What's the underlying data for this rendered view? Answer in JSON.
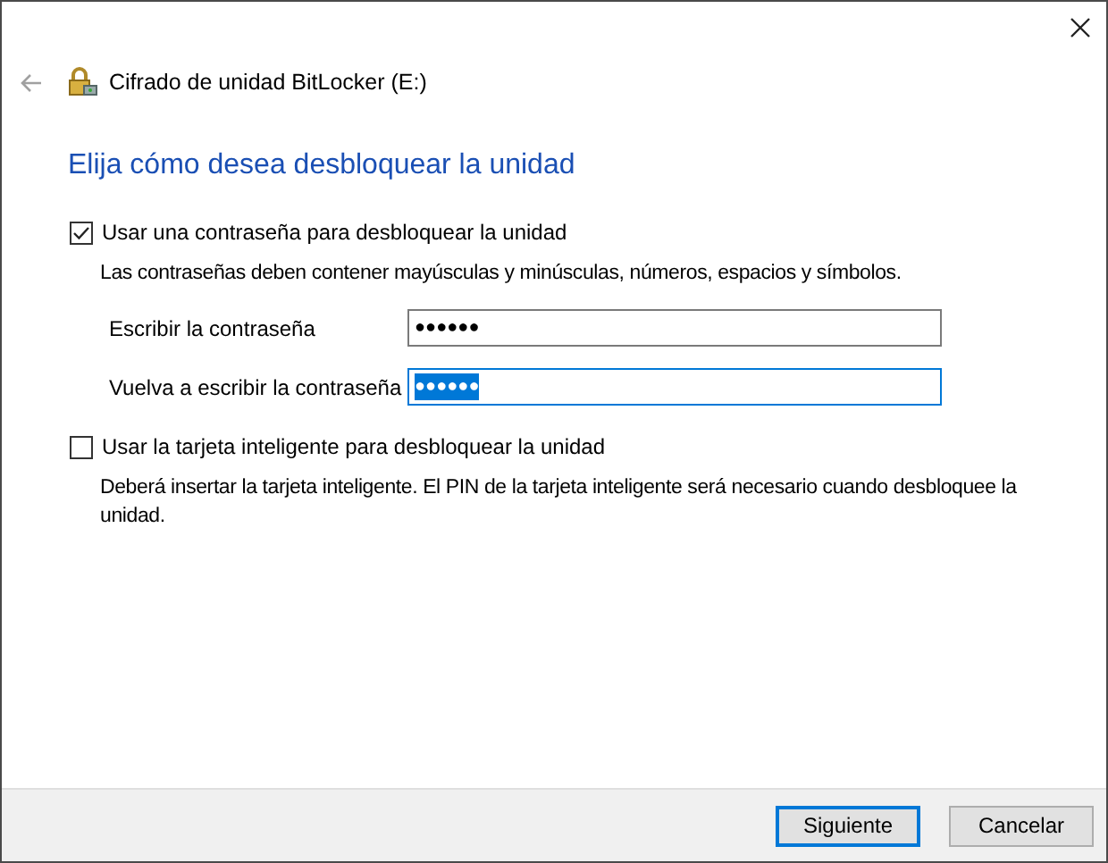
{
  "window": {
    "title": "Cifrado de unidad BitLocker (E:)"
  },
  "heading": "Elija cómo desea desbloquear la unidad",
  "options": [
    {
      "label": "Usar una contraseña para desbloquear la unidad",
      "checked": true,
      "description": "Las contraseñas deben contener mayúsculas y minúsculas, números, espacios y símbolos.",
      "fields": [
        {
          "label": "Escribir la contraseña",
          "value": "●●●●●●",
          "focused": false
        },
        {
          "label": "Vuelva a escribir la contraseña",
          "value": "●●●●●●",
          "focused": true
        }
      ]
    },
    {
      "label": "Usar la tarjeta inteligente para desbloquear la unidad",
      "checked": false,
      "description": "Deberá insertar la tarjeta inteligente. El PIN de la tarjeta inteligente será necesario cuando desbloquee la unidad."
    }
  ],
  "buttons": [
    {
      "label": "Siguiente",
      "default": true
    },
    {
      "label": "Cancelar",
      "default": false
    }
  ]
}
